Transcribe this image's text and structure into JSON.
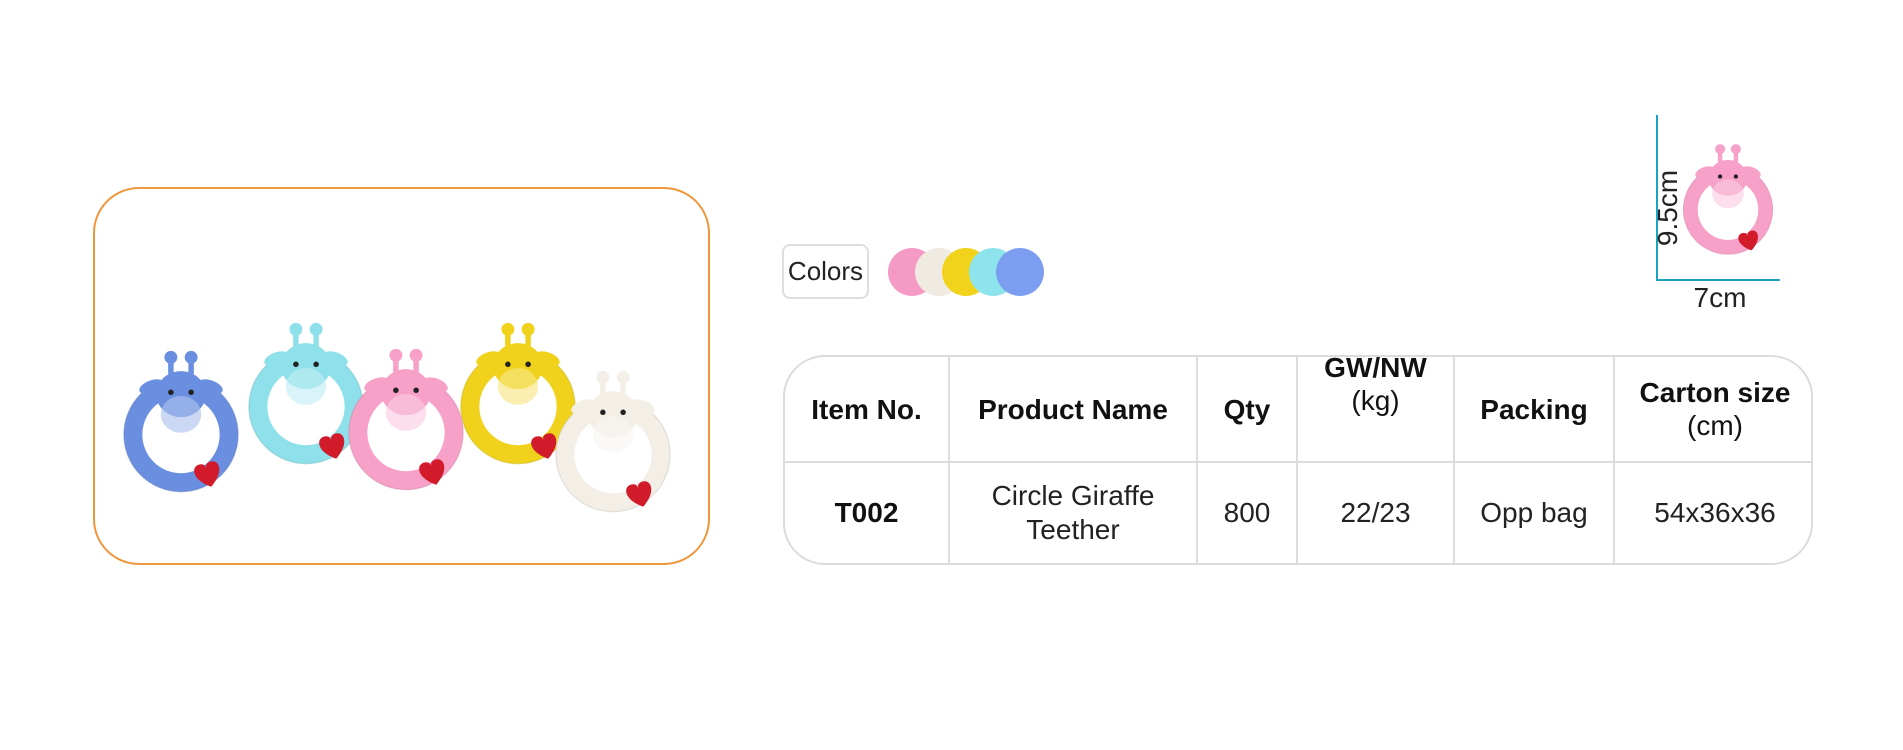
{
  "colors": {
    "label": "Colors",
    "swatches": [
      {
        "name": "pink",
        "hex": "#f59ac4"
      },
      {
        "name": "cream",
        "hex": "#efebe2"
      },
      {
        "name": "yellow",
        "hex": "#f0d31a"
      },
      {
        "name": "aqua",
        "hex": "#8ee4ec"
      },
      {
        "name": "blue",
        "hex": "#7b9ef0"
      }
    ]
  },
  "dimensions": {
    "width": "7cm",
    "height": "9.5cm"
  },
  "table": {
    "headers": {
      "item_no": "Item No.",
      "product_name": "Product Name",
      "qty": "Qty",
      "gw_nw": "GW/NW",
      "gw_nw_unit": "(kg)",
      "packing": "Packing",
      "carton_size": "Carton size",
      "carton_size_unit": "(cm)"
    },
    "row": {
      "item_no": "T002",
      "product_name": "Circle Giraffe Teether",
      "qty": "800",
      "gw_nw": "22/23",
      "packing": "Opp bag",
      "carton_size": "54x36x36"
    }
  },
  "photo": {
    "icon": "giraffe-teether-icon",
    "teether_colors": [
      "#6b8fe0",
      "#8ee0ea",
      "#f7a0c8",
      "#f0d21c",
      "#f3efe7"
    ],
    "heart_color": "#d11a2a",
    "frame_color": "#f0963a"
  }
}
